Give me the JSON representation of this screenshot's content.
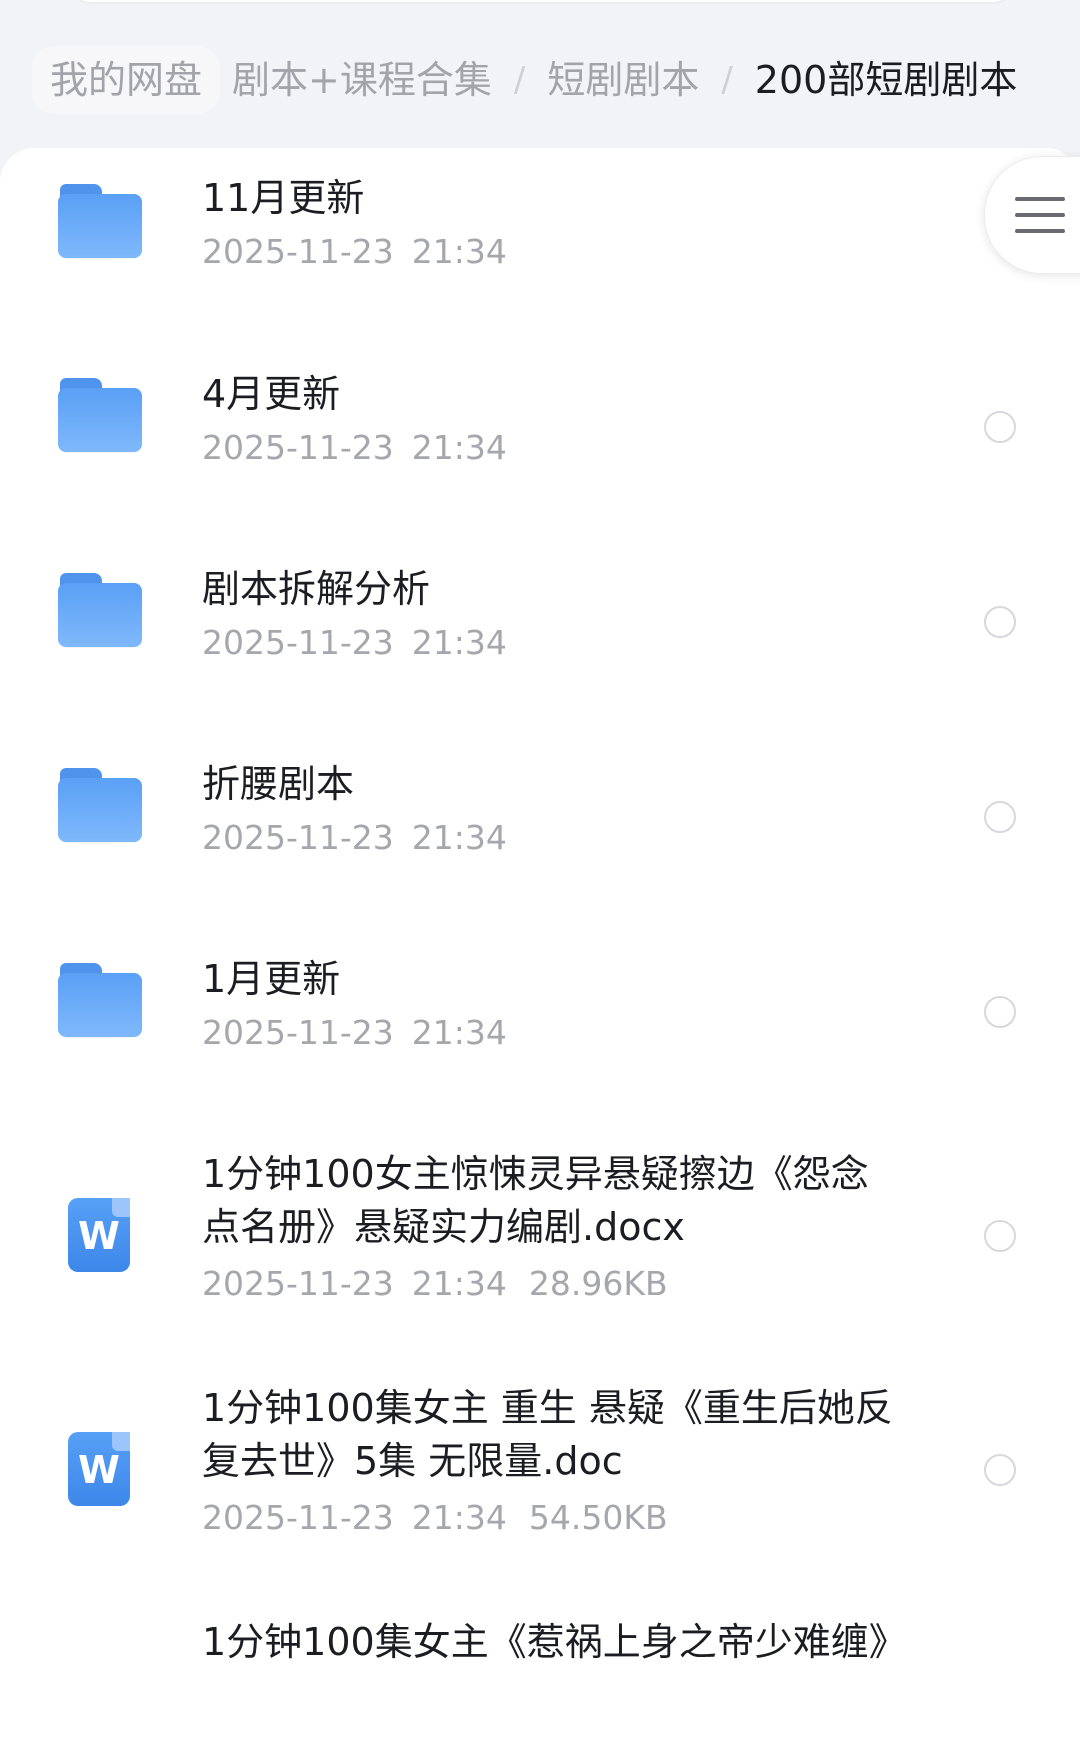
{
  "breadcrumb": {
    "root": "我的网盘",
    "items": [
      "剧本+课程合集",
      "短剧剧本"
    ],
    "current": "200部短剧剧本",
    "separator": "/"
  },
  "files": [
    {
      "type": "folder",
      "icon": "folder-icon",
      "name": "11月更新",
      "date": "2025-11-23",
      "time": "21:34",
      "size": ""
    },
    {
      "type": "folder",
      "icon": "folder-icon",
      "name": "4月更新",
      "date": "2025-11-23",
      "time": "21:34",
      "size": ""
    },
    {
      "type": "folder",
      "icon": "folder-icon",
      "name": "剧本拆解分析",
      "date": "2025-11-23",
      "time": "21:34",
      "size": ""
    },
    {
      "type": "folder",
      "icon": "folder-icon",
      "name": "折腰剧本",
      "date": "2025-11-23",
      "time": "21:34",
      "size": ""
    },
    {
      "type": "folder",
      "icon": "folder-icon",
      "name": "1月更新",
      "date": "2025-11-23",
      "time": "21:34",
      "size": ""
    },
    {
      "type": "doc",
      "icon": "word-doc-icon",
      "icon_letter": "W",
      "name_line1": "1分钟100女主惊悚灵异悬疑擦边《怨念",
      "name_line2": "点名册》悬疑实力编剧.docx",
      "date": "2025-11-23",
      "time": "21:34",
      "size": "28.96KB"
    },
    {
      "type": "doc",
      "icon": "word-doc-icon",
      "icon_letter": "W",
      "name_line1": "1分钟100集女主 重生 悬疑《重生后她反",
      "name_line2": "复去世》5集 无限量.doc",
      "date": "2025-11-23",
      "time": "21:34",
      "size": "54.50KB"
    },
    {
      "type": "doc",
      "icon": "word-doc-icon",
      "name_line1": "1分钟100集女主《惹祸上身之帝少难缠》"
    }
  ],
  "colors": {
    "accent": "#4f93ec",
    "text_primary": "#1c1d22",
    "text_secondary": "#a6a7ad",
    "background": "#f2f3f7"
  },
  "menu_button": {
    "icon": "hamburger-menu-icon"
  }
}
